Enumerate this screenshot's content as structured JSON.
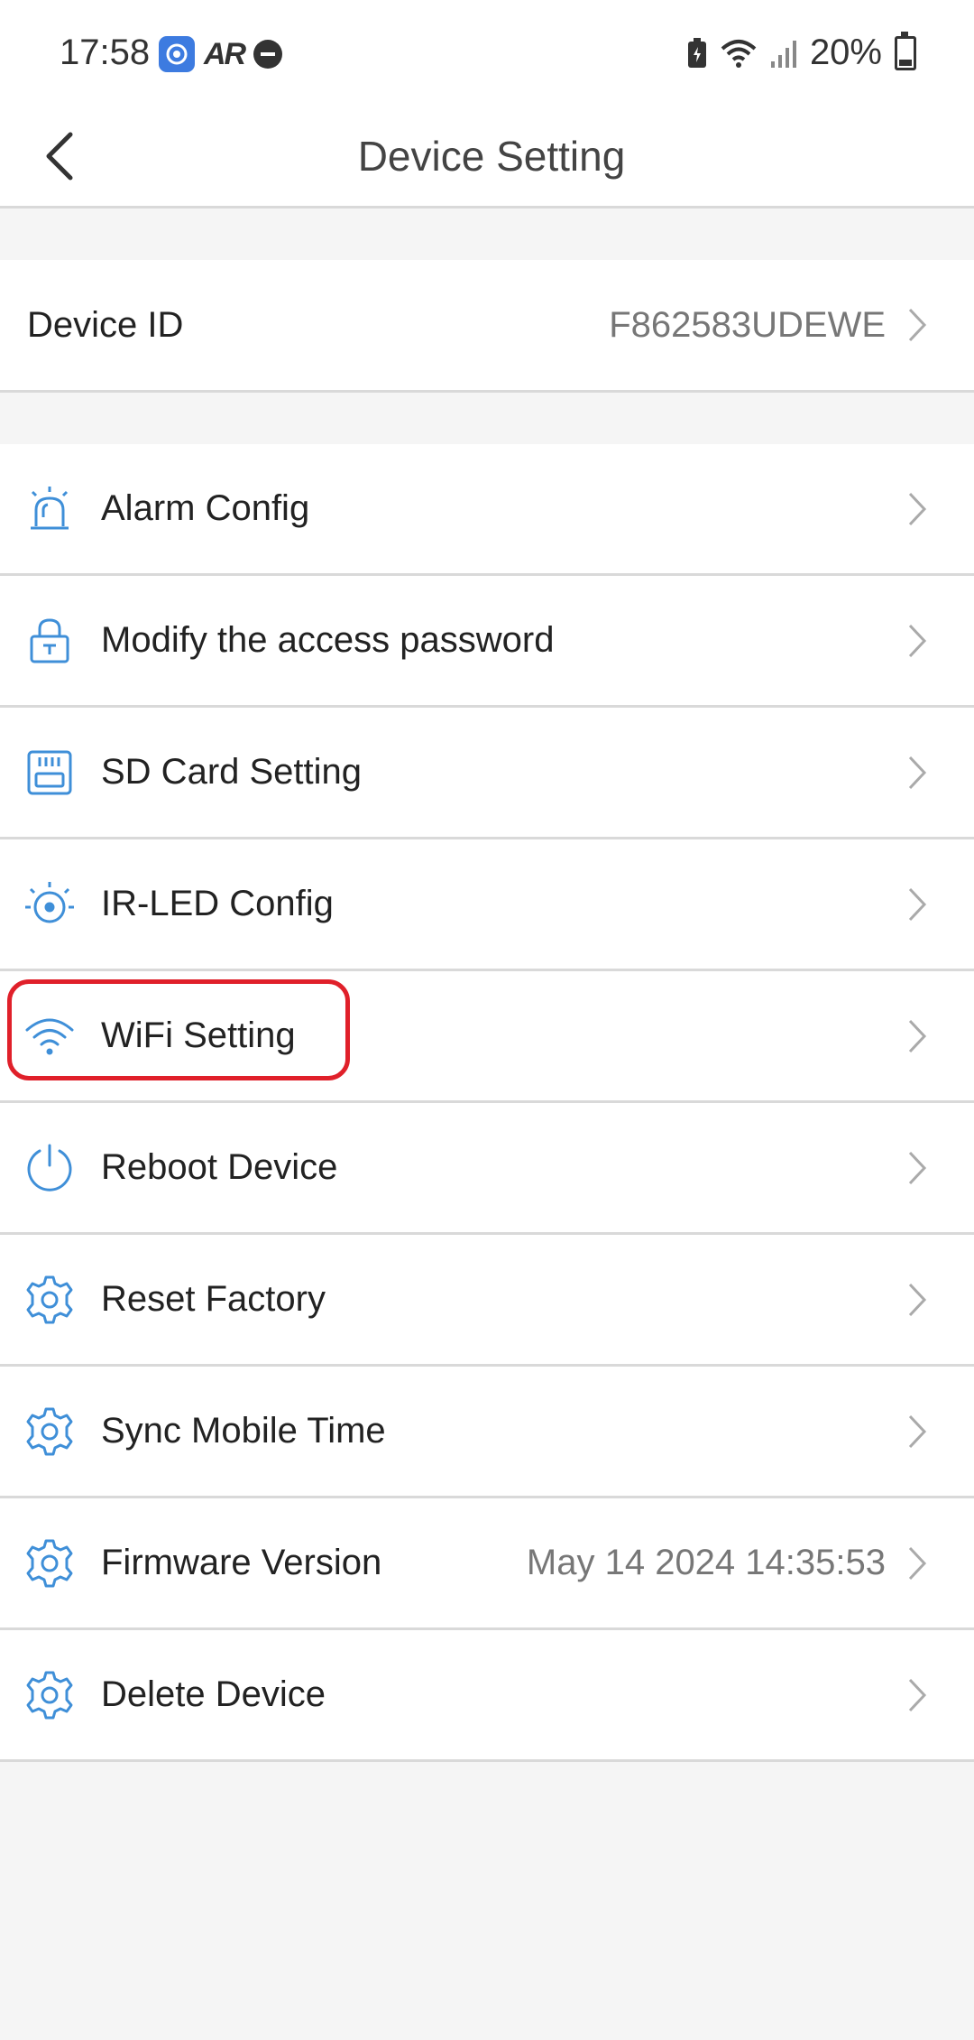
{
  "status_bar": {
    "time": "17:58",
    "ar_label": "AR",
    "battery_percent": "20%",
    "icons": [
      "app-icon",
      "dnd-icon",
      "battery-saver-icon",
      "wifi-icon",
      "signal-icon",
      "battery-icon"
    ]
  },
  "header": {
    "title": "Device Setting",
    "back_icon": "back-chevron-icon"
  },
  "device": {
    "label": "Device ID",
    "value": "F862583UDEWE"
  },
  "menu": {
    "items": [
      {
        "label": "Alarm Config",
        "icon": "alarm-icon",
        "value": ""
      },
      {
        "label": "Modify the access password",
        "icon": "lock-icon",
        "value": ""
      },
      {
        "label": "SD Card Setting",
        "icon": "sd-card-icon",
        "value": ""
      },
      {
        "label": "IR-LED Config",
        "icon": "ir-led-icon",
        "value": ""
      },
      {
        "label": "WiFi Setting",
        "icon": "wifi-icon",
        "value": ""
      },
      {
        "label": "Reboot Device",
        "icon": "power-icon",
        "value": ""
      },
      {
        "label": "Reset Factory",
        "icon": "gear-icon",
        "value": ""
      },
      {
        "label": "Sync Mobile Time",
        "icon": "gear-icon",
        "value": ""
      },
      {
        "label": "Firmware Version",
        "icon": "gear-icon",
        "value": "May 14 2024 14:35:53"
      },
      {
        "label": "Delete Device",
        "icon": "gear-icon",
        "value": ""
      }
    ]
  },
  "colors": {
    "accent_blue": "#3f8fd8",
    "highlight_red": "#e0202a",
    "background": "#f5f5f5",
    "divider": "#d9d9d9"
  }
}
